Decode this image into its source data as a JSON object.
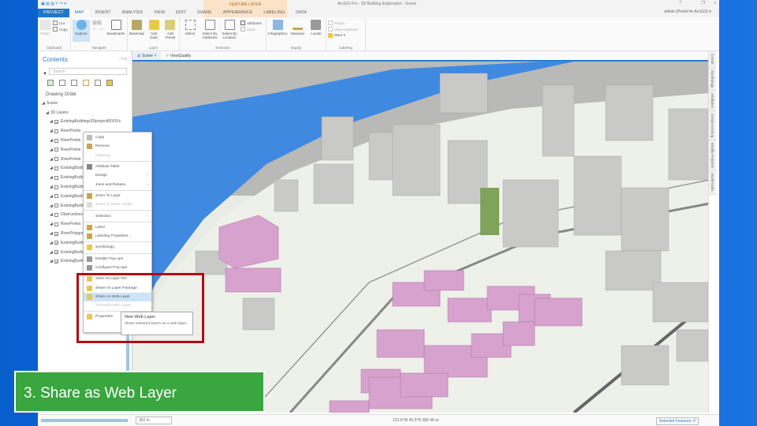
{
  "title_bar": {
    "text": "ArcGIS Pro - 3D Building Exploration - Scene",
    "help": "?",
    "restore": "❐",
    "close": "x"
  },
  "context_tab": "FEATURE LAYER",
  "tabs": [
    "PROJECT",
    "MAP",
    "INSERT",
    "ANALYSIS",
    "VIEW",
    "EDIT",
    "SHARE",
    "APPEARANCE",
    "LABELING",
    "DATA"
  ],
  "user": "admin (Portal for ArcGIS) ▾",
  "ribbon": {
    "clipboard": {
      "label": "Clipboard",
      "paste": "Paste",
      "cut": "Cut",
      "copy": "Copy"
    },
    "navigate": {
      "label": "Navigate",
      "explore": "Explore",
      "bookmarks": "Bookmarks"
    },
    "layer": {
      "label": "Layer",
      "basemap": "Basemap",
      "add_data": "Add Data",
      "add_preset": "Add Preset"
    },
    "selection": {
      "label": "Selection",
      "select": "Select",
      "by_attributes": "Select By Attributes",
      "by_location": "Select By Location",
      "attributes": "Attributes",
      "clear": "Clear"
    },
    "inquiry": {
      "label": "Inquiry",
      "infographics": "Infographics",
      "measure": "Measure",
      "locate": "Locate"
    },
    "labeling": {
      "label": "Labeling",
      "pause": "Pause",
      "view_unplaced": "View Unplaced",
      "more": "More ▾"
    }
  },
  "contents": {
    "title": "Contents",
    "pin": "- ⊓ x",
    "search_placeholder": "Search",
    "drawing_order": "Drawing Order",
    "tree": [
      {
        "label": "Scene",
        "indent": 1
      },
      {
        "label": "3D Layers",
        "indent": 2
      },
      {
        "label": "ExistingBuildings3DprojectROOFs",
        "indent": 3,
        "checked": true
      },
      {
        "label": "RiverPoints",
        "indent": 3
      },
      {
        "label": "RiverPoints",
        "indent": 3
      },
      {
        "label": "RiverPoints",
        "indent": 3
      },
      {
        "label": "RiverPoints",
        "indent": 3
      },
      {
        "label": "ExistingBuildings",
        "indent": 3
      },
      {
        "label": "ExistingBuildings",
        "indent": 3
      },
      {
        "label": "ExistingBuildings",
        "indent": 3
      },
      {
        "label": "ExistingBuildings",
        "indent": 3
      },
      {
        "label": "ExistingBuildings",
        "indent": 3
      },
      {
        "label": "Obstructions",
        "indent": 3
      },
      {
        "label": "RiverPoints",
        "indent": 3
      },
      {
        "label": "RiverPolygon",
        "indent": 3,
        "checked": true
      },
      {
        "label": "ExistingBuildingsViewQuality",
        "indent": 3,
        "checked": true
      },
      {
        "label": "ExistingBuildingsRoof",
        "indent": 3,
        "checked": true
      },
      {
        "label": "ExistingBuildingsToBeDemolished",
        "indent": 3,
        "checked": true
      }
    ]
  },
  "map": {
    "tabs": [
      "Scene",
      "ViewQuality"
    ]
  },
  "context_menu": [
    {
      "label": "Copy"
    },
    {
      "label": "Remove"
    },
    {
      "label": "Ungroup",
      "disabled": true
    },
    {
      "sep": true
    },
    {
      "label": "Attribute Table"
    },
    {
      "label": "Design",
      "sub": true
    },
    {
      "label": "Joins and Relates",
      "sub": true
    },
    {
      "sep": true
    },
    {
      "label": "Zoom To Layer"
    },
    {
      "label": "Zoom To Make Visible",
      "disabled": true
    },
    {
      "sep": true
    },
    {
      "label": "Selection",
      "sub": true
    },
    {
      "sep": true
    },
    {
      "label": "Label"
    },
    {
      "label": "Labeling Properties..."
    },
    {
      "sep": true
    },
    {
      "label": "Symbology"
    },
    {
      "sep": true
    },
    {
      "label": "Disable Pop-ups"
    },
    {
      "label": "Configure Pop-ups"
    },
    {
      "sep": true
    },
    {
      "label": "Save As Layer File"
    },
    {
      "label": "Share As Layer Package"
    },
    {
      "label": "Share As Web Layer",
      "highlight": true
    },
    {
      "label": "Overwrite Web Layer",
      "disabled": true
    },
    {
      "sep": true
    },
    {
      "label": "Properties"
    }
  ],
  "tooltip": {
    "title": "New Web Layer",
    "body": "Share selected layers as a web layer."
  },
  "right_panes": [
    "Create",
    "Symbology",
    "Attributes",
    "Geoprocessing",
    "Modify Features",
    "Bookmarks"
  ],
  "status": {
    "scale": "352 m",
    "coordinates": "122.6°W 45.5°N 382.46 m",
    "selected_features": "Selected Features: 0"
  },
  "caption": "3. Share as Web Layer"
}
